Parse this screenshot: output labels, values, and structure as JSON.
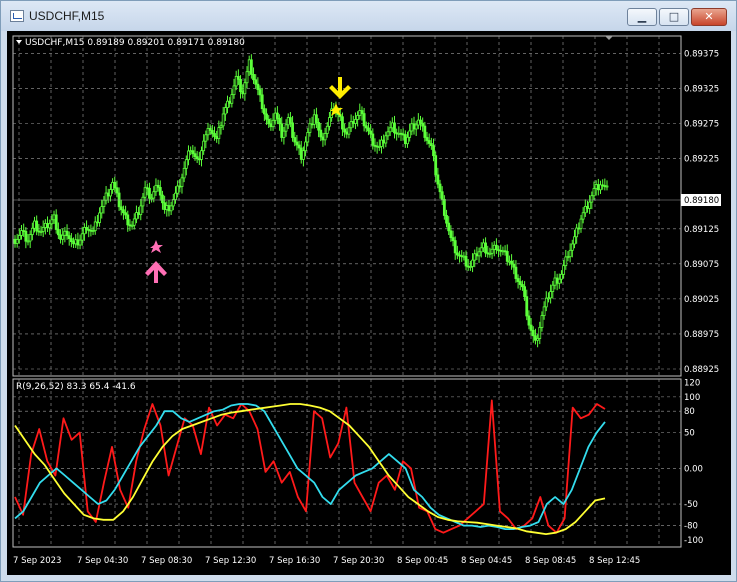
{
  "window": {
    "title": "USDCHF,M15",
    "controls": {
      "minimize": "▁",
      "maximize": "□",
      "close": "✕"
    }
  },
  "chart": {
    "header": "USDCHF,M15  0.89189 0.89201 0.89171 0.89180",
    "indicator_header": "R(9,26,52) 83.3 65.4 -41.6",
    "current_price": "0.89180",
    "colors": {
      "background": "#000000",
      "candles": "#5cff3a",
      "grid": "#9e9e9e",
      "rsi_fast": "#ff1a1a",
      "rsi_mid": "#33ddee",
      "rsi_slow": "#ffff33",
      "sell_signal": "#ffee00",
      "buy_signal": "#ff6fb5"
    },
    "signals": [
      {
        "type": "sell",
        "icon": "arrow-down-icon",
        "time": "7 Sep 20:15"
      },
      {
        "type": "buy",
        "icon": "arrow-up-icon",
        "time": "7 Sep 08:00"
      }
    ]
  },
  "chart_data": [
    {
      "type": "candlestick",
      "y_ticks": [
        "0.89375",
        "0.89325",
        "0.89275",
        "0.89225",
        "0.89125",
        "0.89075",
        "0.89025",
        "0.88975",
        "0.88925"
      ],
      "ylim": [
        0.88915,
        0.894
      ],
      "x_ticks": [
        "7 Sep 2023",
        "7 Sep 04:30",
        "7 Sep 08:30",
        "7 Sep 12:30",
        "7 Sep 16:30",
        "7 Sep 20:30",
        "8 Sep 00:45",
        "8 Sep 04:45",
        "8 Sep 08:45",
        "8 Sep 12:45"
      ],
      "close_path": [
        0.8911,
        0.8912,
        0.8911,
        0.8913,
        0.8912,
        0.8913,
        0.8914,
        0.8911,
        0.8912,
        0.891,
        0.8911,
        0.8913,
        0.8912,
        0.8915,
        0.8917,
        0.8919,
        0.8916,
        0.8914,
        0.8913,
        0.8915,
        0.8918,
        0.8917,
        0.8919,
        0.8915,
        0.8916,
        0.8918,
        0.8921,
        0.8924,
        0.8922,
        0.8925,
        0.8927,
        0.8925,
        0.8929,
        0.8931,
        0.8934,
        0.8932,
        0.8936,
        0.8933,
        0.893,
        0.8927,
        0.8929,
        0.8926,
        0.8928,
        0.8925,
        0.8923,
        0.8926,
        0.8929,
        0.8925,
        0.8927,
        0.893,
        0.8928,
        0.8926,
        0.8928,
        0.8929,
        0.8927,
        0.8925,
        0.8924,
        0.8926,
        0.8927,
        0.8926,
        0.8925,
        0.8927,
        0.8928,
        0.8926,
        0.8924,
        0.8919,
        0.8915,
        0.8911,
        0.8909,
        0.8908,
        0.8907,
        0.8909,
        0.891,
        0.8909,
        0.891,
        0.8909,
        0.8908,
        0.8906,
        0.8904,
        0.8899,
        0.8896,
        0.89,
        0.8903,
        0.8905,
        0.8906,
        0.8909,
        0.8911,
        0.8914,
        0.8916,
        0.8918,
        0.8919,
        0.8918
      ],
      "last_price": 0.8918
    },
    {
      "type": "line",
      "y_ticks": [
        "120",
        "100",
        "80",
        "50",
        "0.00",
        "-50",
        "-80",
        "-100"
      ],
      "ylim": [
        -110,
        125
      ],
      "series": [
        {
          "color": "#ff1a1a",
          "values": [
            -40,
            -65,
            20,
            55,
            10,
            -10,
            70,
            40,
            50,
            -60,
            -75,
            -20,
            30,
            -30,
            -55,
            10,
            55,
            90,
            60,
            -10,
            30,
            70,
            60,
            20,
            85,
            60,
            75,
            70,
            90,
            80,
            55,
            -5,
            10,
            -20,
            -5,
            -40,
            -60,
            80,
            70,
            15,
            35,
            85,
            -20,
            -40,
            -60,
            -20,
            -10,
            -30,
            10,
            0,
            -55,
            -60,
            -85,
            -90,
            -85,
            -80,
            -70,
            -60,
            -50,
            95,
            -60,
            -70,
            -85,
            -80,
            -70,
            -40,
            -80,
            -90,
            -70,
            85,
            70,
            75,
            90,
            83
          ]
        },
        {
          "color": "#33ddee",
          "values": [
            -70,
            -60,
            -40,
            -20,
            -10,
            0,
            -10,
            -20,
            -30,
            -40,
            -50,
            -45,
            -30,
            -10,
            10,
            30,
            45,
            60,
            80,
            80,
            70,
            65,
            70,
            75,
            80,
            82,
            88,
            90,
            90,
            88,
            80,
            60,
            40,
            20,
            0,
            -10,
            -20,
            -40,
            -50,
            -30,
            -20,
            -10,
            -5,
            0,
            10,
            20,
            10,
            0,
            -30,
            -40,
            -55,
            -65,
            -70,
            -75,
            -80,
            -80,
            -82,
            -80,
            -82,
            -85,
            -85,
            -82,
            -80,
            -75,
            -50,
            -40,
            -50,
            -30,
            0,
            30,
            50,
            65
          ]
        },
        {
          "color": "#ffff33",
          "values": [
            60,
            40,
            20,
            5,
            -15,
            -35,
            -50,
            -65,
            -70,
            -72,
            -72,
            -60,
            -40,
            -15,
            10,
            30,
            45,
            55,
            60,
            65,
            70,
            75,
            78,
            80,
            82,
            84,
            86,
            88,
            90,
            90,
            88,
            85,
            80,
            70,
            60,
            45,
            30,
            10,
            -10,
            -25,
            -40,
            -50,
            -60,
            -68,
            -72,
            -74,
            -75,
            -76,
            -78,
            -80,
            -82,
            -84,
            -88,
            -90,
            -92,
            -90,
            -85,
            -75,
            -60,
            -45,
            -42
          ]
        }
      ]
    }
  ]
}
